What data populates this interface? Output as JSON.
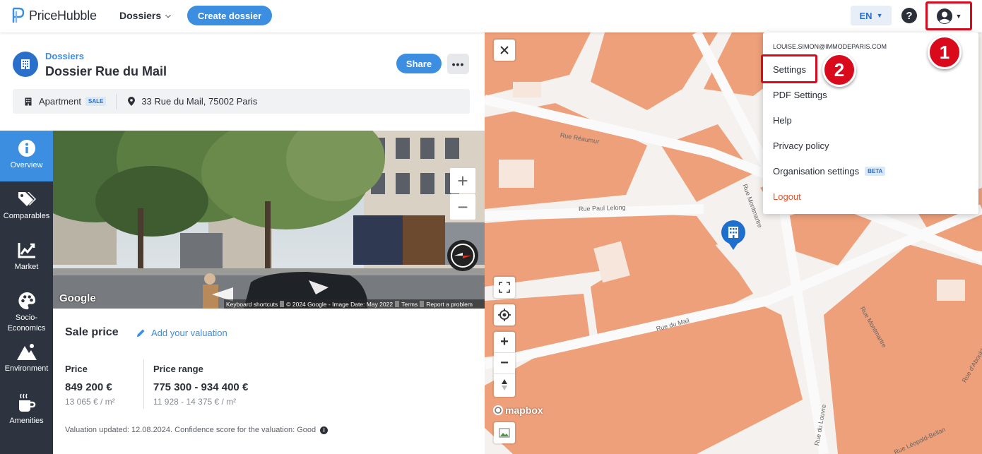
{
  "topbar": {
    "brand": "PriceHubble",
    "nav_dossiers": "Dossiers",
    "create_button": "Create dossier",
    "language": "EN"
  },
  "dossier": {
    "breadcrumb": "Dossiers",
    "title": "Dossier Rue du Mail",
    "share_button": "Share",
    "property_type": "Apartment",
    "deal_badge": "SALE",
    "address": "33 Rue du Mail, 75002 Paris"
  },
  "side_nav": [
    {
      "label": "Overview",
      "icon": "info-icon",
      "active": true
    },
    {
      "label": "Comparables",
      "icon": "tags-icon",
      "active": false
    },
    {
      "label": "Market",
      "icon": "chart-icon",
      "active": false
    },
    {
      "label": "Socio-\nEconomics",
      "icon": "palette-icon",
      "active": false
    },
    {
      "label": "Environment",
      "icon": "mountain-icon",
      "active": false
    },
    {
      "label": "Amenities",
      "icon": "coffee-icon",
      "active": false
    }
  ],
  "street_view": {
    "google": "Google",
    "footer": [
      "Keyboard shortcuts",
      "© 2024 Google - Image Date: May 2022",
      "Terms",
      "Report a problem"
    ]
  },
  "valuation": {
    "title": "Sale price",
    "add_link": "Add your valuation",
    "price_label": "Price",
    "price_value": "849 200 €",
    "price_per_m2": "13 065 € / m²",
    "range_label": "Price range",
    "range_value": "775 300 - 934 400 €",
    "range_per_m2": "11 928 - 14 375 € / m²",
    "note": "Valuation updated: 12.08.2024. Confidence score for the valuation: Good"
  },
  "map": {
    "mapbox": "mapbox",
    "streets": [
      "Rue Réaumur",
      "Rue Paul Lelong",
      "Rue du Mail",
      "Rue du Louvre",
      "Rue Montmartre",
      "Rue Montmartre",
      "Rue d'Aboukir",
      "Rue Léopold-Bellan"
    ]
  },
  "user_menu": {
    "email": "LOUISE.SIMON@IMMODEPARIS.COM",
    "items": [
      "Settings",
      "PDF Settings",
      "Help",
      "Privacy policy",
      "Organisation settings",
      "Logout"
    ],
    "beta_badge": "BETA"
  },
  "annotations": [
    "1",
    "2"
  ],
  "colors": {
    "accent": "#3b8ee0",
    "sidebar": "#2d3440",
    "map_building": "#eea07a",
    "highlight": "#d90a1b",
    "logout": "#e0532c"
  }
}
